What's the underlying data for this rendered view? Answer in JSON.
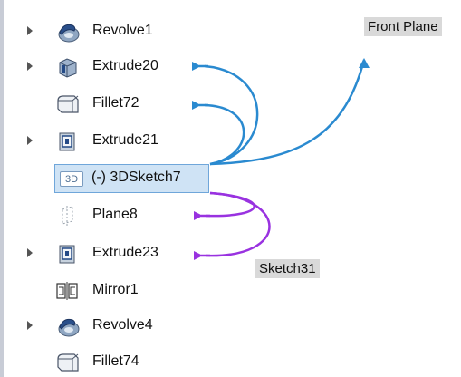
{
  "tree": {
    "items": [
      {
        "label": "Revolve1",
        "icon": "revolve-icon",
        "expandable": true
      },
      {
        "label": "Extrude20",
        "icon": "extrude-icon",
        "expandable": true
      },
      {
        "label": "Fillet72",
        "icon": "fillet-icon",
        "expandable": false
      },
      {
        "label": "Extrude21",
        "icon": "extrude-icon",
        "expandable": true
      },
      {
        "label": "(-) 3DSketch7",
        "icon": "3d-sketch-icon",
        "expandable": false,
        "selected": true,
        "badge": "3D"
      },
      {
        "label": "Plane8",
        "icon": "plane-icon",
        "expandable": false
      },
      {
        "label": "Extrude23",
        "icon": "extrude-icon",
        "expandable": true
      },
      {
        "label": "Mirror1",
        "icon": "mirror-icon",
        "expandable": false
      },
      {
        "label": "Revolve4",
        "icon": "revolve-icon",
        "expandable": true
      },
      {
        "label": "Fillet74",
        "icon": "fillet-icon",
        "expandable": false
      }
    ]
  },
  "callouts": {
    "front_plane": "Front Plane",
    "sketch31": "Sketch31"
  },
  "colors": {
    "parent_arrows": "#2a8ad0",
    "child_arrows": "#9932e0",
    "selection_fill": "#cfe3f5",
    "selection_border": "#6fa6da"
  }
}
